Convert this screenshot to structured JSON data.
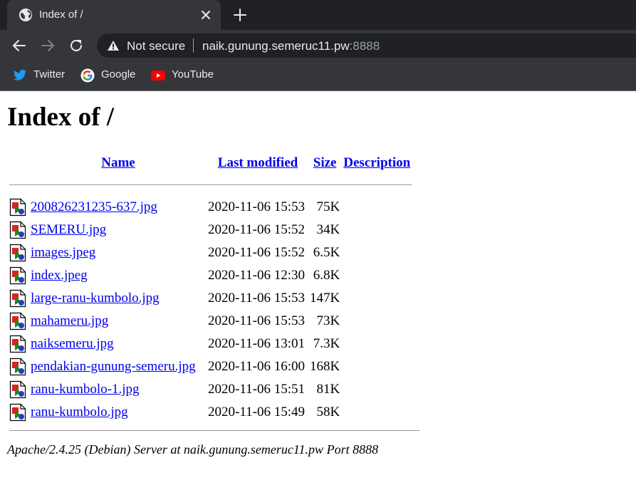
{
  "browser": {
    "tab": {
      "title": "Index of /",
      "favicon": "globe-icon"
    },
    "new_tab_icon": "plus-icon",
    "address_bar": {
      "security_label": "Not secure",
      "host": "naik.gunung.semeruc11.pw",
      "port": ":8888"
    },
    "bookmarks": [
      {
        "label": "Twitter",
        "icon": "twitter-icon"
      },
      {
        "label": "Google",
        "icon": "google-icon"
      },
      {
        "label": "YouTube",
        "icon": "youtube-icon"
      }
    ]
  },
  "page": {
    "heading": "Index of /",
    "columns": {
      "name": "Name",
      "last_modified": "Last modified",
      "size": "Size",
      "description": "Description"
    },
    "files": [
      {
        "name": "200826231235-637.jpg",
        "modified": "2020-11-06 15:53",
        "size": "75K"
      },
      {
        "name": "SEMERU.jpg",
        "modified": "2020-11-06 15:52",
        "size": "34K"
      },
      {
        "name": "images.jpeg",
        "modified": "2020-11-06 15:52",
        "size": "6.5K"
      },
      {
        "name": "index.jpeg",
        "modified": "2020-11-06 12:30",
        "size": "6.8K"
      },
      {
        "name": "large-ranu-kumbolo.jpg",
        "modified": "2020-11-06 15:53",
        "size": "147K"
      },
      {
        "name": "mahameru.jpg",
        "modified": "2020-11-06 15:53",
        "size": "73K"
      },
      {
        "name": "naiksemeru.jpg",
        "modified": "2020-11-06 13:01",
        "size": "7.3K"
      },
      {
        "name": "pendakian-gunung-semeru.jpg",
        "modified": "2020-11-06 16:00",
        "size": "168K"
      },
      {
        "name": "ranu-kumbolo-1.jpg",
        "modified": "2020-11-06 15:51",
        "size": "81K"
      },
      {
        "name": "ranu-kumbolo.jpg",
        "modified": "2020-11-06 15:49",
        "size": "58K"
      }
    ],
    "footer": "Apache/2.4.25 (Debian) Server at naik.gunung.semeruc11.pw Port 8888"
  },
  "colors": {
    "chrome_dark": "#202124",
    "chrome_toolbar": "#35363a",
    "link": "#0000ee"
  }
}
